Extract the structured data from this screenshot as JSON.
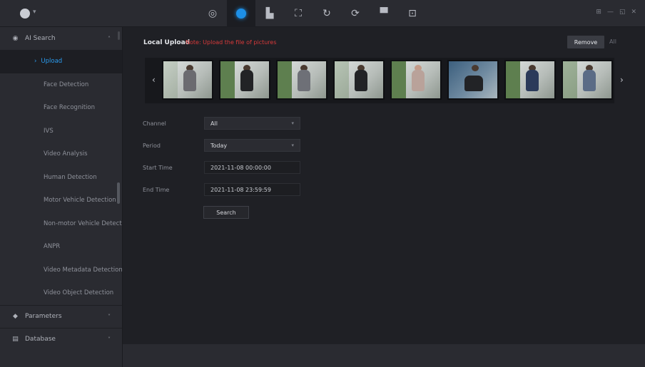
{
  "topbar": {
    "logo_caret": "▾",
    "nav_icons": [
      "camera-shutter-icon",
      "ai-sphere-icon",
      "person-icon",
      "people-counting-icon",
      "refresh-icon",
      "sync-icon",
      "display-icon",
      "playback-icon"
    ],
    "right_items": [
      "⊞",
      "—",
      "◱",
      "✕"
    ],
    "accent": "#1d8fe6"
  },
  "sidebar": {
    "top_category": {
      "label": "AI Search"
    },
    "items": [
      {
        "label": "Upload"
      },
      {
        "label": "Face Detection"
      },
      {
        "label": "Face Recognition"
      },
      {
        "label": "IVS"
      },
      {
        "label": "Video Analysis"
      },
      {
        "label": "Human Detection"
      },
      {
        "label": "Motor Vehicle Detection"
      },
      {
        "label": "Non-motor Vehicle Detection"
      },
      {
        "label": "ANPR"
      },
      {
        "label": "Video Metadata Detection"
      },
      {
        "label": "Video Object Detection"
      }
    ],
    "categories": [
      {
        "label": "Parameters"
      },
      {
        "label": "Database"
      }
    ]
  },
  "main": {
    "title": "Local Upload",
    "note": "Note: Upload the file of pictures",
    "remove_label": "Remove",
    "all_label": "All",
    "strip": {
      "prev": "‹",
      "next": "›",
      "thumb_count": 8
    },
    "form": {
      "channel_label": "Channel",
      "channel_value": "All",
      "period_label": "Period",
      "period_value": "Today",
      "start_label": "Start Time",
      "start_value": "2021-11-08 00:00:00",
      "end_label": "End Time",
      "end_value": "2021-11-08 23:59:59",
      "search_label": "Search"
    }
  }
}
